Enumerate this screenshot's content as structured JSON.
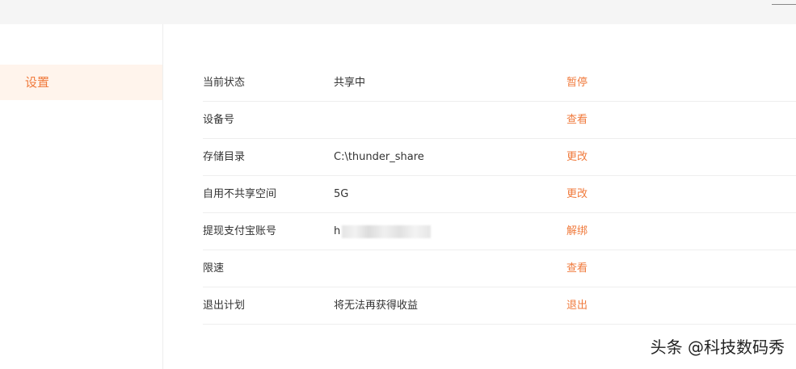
{
  "sidebar": {
    "items": [
      {
        "label": "设置",
        "active": true
      }
    ]
  },
  "settings": {
    "rows": [
      {
        "label": "当前状态",
        "value": "共享中",
        "action": "暂停"
      },
      {
        "label": "设备号",
        "value": "",
        "action": "查看"
      },
      {
        "label": "存储目录",
        "value": "C:\\thunder_share",
        "action": "更改"
      },
      {
        "label": "自用不共享空间",
        "value": "5G",
        "action": "更改"
      },
      {
        "label": "提现支付宝账号",
        "value": "h",
        "value_masked": true,
        "action": "解绑"
      },
      {
        "label": "限速",
        "value": "",
        "action": "查看"
      },
      {
        "label": "退出计划",
        "value": "将无法再获得收益",
        "action": "退出"
      }
    ]
  },
  "watermark": {
    "text": "头条 @科技数码秀"
  },
  "colors": {
    "accent": "#f07a3c",
    "active_bg": "#fff4ec",
    "divider": "#eeeeee",
    "topbar_bg": "#f5f5f5",
    "text": "#333333"
  }
}
